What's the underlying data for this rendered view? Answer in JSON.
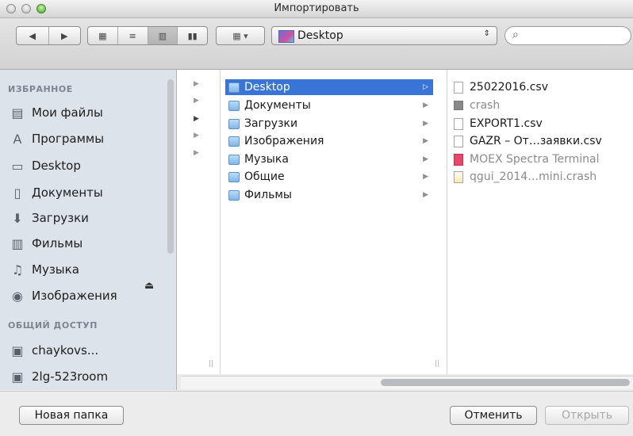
{
  "window": {
    "title": "Импортировать"
  },
  "toolbar": {
    "nav_back_icon": "chevron-left",
    "nav_forward_icon": "chevron-right",
    "view_modes": [
      "icon-view",
      "list-view",
      "column-view",
      "coverflow-view"
    ],
    "active_view": "column-view",
    "arrange_icon": "grid-menu",
    "location": "Desktop",
    "search_placeholder": ""
  },
  "sidebar": {
    "favorites_header": "ИЗБРАННОЕ",
    "favorites": [
      {
        "label": "Мои файлы",
        "icon": "all-files-icon"
      },
      {
        "label": "Программы",
        "icon": "applications-icon"
      },
      {
        "label": "Desktop",
        "icon": "desktop-icon"
      },
      {
        "label": "Документы",
        "icon": "documents-icon"
      },
      {
        "label": "Загрузки",
        "icon": "downloads-icon"
      },
      {
        "label": "Фильмы",
        "icon": "movies-icon"
      },
      {
        "label": "Музыка",
        "icon": "music-icon"
      },
      {
        "label": "Изображения",
        "icon": "pictures-icon"
      }
    ],
    "shared_header": "ОБЩИЙ ДОСТУП",
    "shared": [
      {
        "label": "chaykovs...",
        "icon": "computer-icon"
      },
      {
        "label": "2lg-523room",
        "icon": "computer-icon"
      }
    ]
  },
  "columns": {
    "folders": [
      {
        "label": "Desktop",
        "selected": true
      },
      {
        "label": "Документы"
      },
      {
        "label": "Загрузки"
      },
      {
        "label": "Изображения"
      },
      {
        "label": "Музыка"
      },
      {
        "label": "Общие"
      },
      {
        "label": "Фильмы"
      }
    ],
    "files": [
      {
        "label": "25022016.csv",
        "dimmed": false
      },
      {
        "label": "crash",
        "dimmed": true
      },
      {
        "label": "EXPORT1.csv",
        "dimmed": false
      },
      {
        "label": "GAZR – От…заявки.csv",
        "dimmed": false
      },
      {
        "label": "MOEX Spectra Terminal",
        "dimmed": true
      },
      {
        "label": "qgui_2014…mini.crash",
        "dimmed": true
      }
    ]
  },
  "buttons": {
    "new_folder": "Новая папка",
    "cancel": "Отменить",
    "open": "Открыть"
  },
  "colors": {
    "selection": "#3875d7",
    "sidebar_bg": "#dde3ea"
  }
}
